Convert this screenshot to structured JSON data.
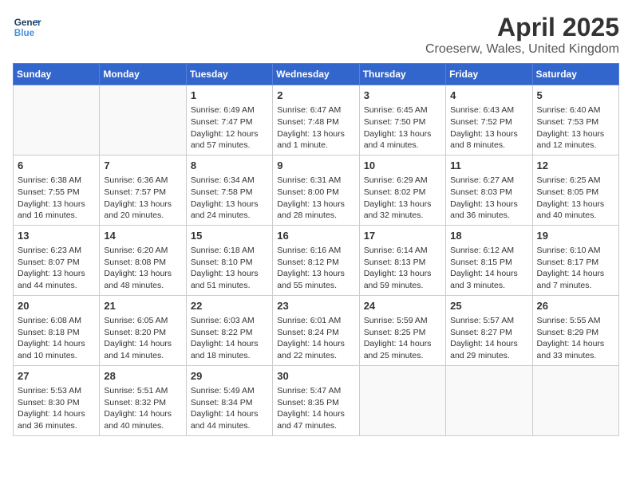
{
  "header": {
    "logo_line1": "General",
    "logo_line2": "Blue",
    "title": "April 2025",
    "subtitle": "Croeserw, Wales, United Kingdom"
  },
  "days_of_week": [
    "Sunday",
    "Monday",
    "Tuesday",
    "Wednesday",
    "Thursday",
    "Friday",
    "Saturday"
  ],
  "weeks": [
    [
      {
        "day": "",
        "detail": ""
      },
      {
        "day": "",
        "detail": ""
      },
      {
        "day": "1",
        "detail": "Sunrise: 6:49 AM\nSunset: 7:47 PM\nDaylight: 12 hours and 57 minutes."
      },
      {
        "day": "2",
        "detail": "Sunrise: 6:47 AM\nSunset: 7:48 PM\nDaylight: 13 hours and 1 minute."
      },
      {
        "day": "3",
        "detail": "Sunrise: 6:45 AM\nSunset: 7:50 PM\nDaylight: 13 hours and 4 minutes."
      },
      {
        "day": "4",
        "detail": "Sunrise: 6:43 AM\nSunset: 7:52 PM\nDaylight: 13 hours and 8 minutes."
      },
      {
        "day": "5",
        "detail": "Sunrise: 6:40 AM\nSunset: 7:53 PM\nDaylight: 13 hours and 12 minutes."
      }
    ],
    [
      {
        "day": "6",
        "detail": "Sunrise: 6:38 AM\nSunset: 7:55 PM\nDaylight: 13 hours and 16 minutes."
      },
      {
        "day": "7",
        "detail": "Sunrise: 6:36 AM\nSunset: 7:57 PM\nDaylight: 13 hours and 20 minutes."
      },
      {
        "day": "8",
        "detail": "Sunrise: 6:34 AM\nSunset: 7:58 PM\nDaylight: 13 hours and 24 minutes."
      },
      {
        "day": "9",
        "detail": "Sunrise: 6:31 AM\nSunset: 8:00 PM\nDaylight: 13 hours and 28 minutes."
      },
      {
        "day": "10",
        "detail": "Sunrise: 6:29 AM\nSunset: 8:02 PM\nDaylight: 13 hours and 32 minutes."
      },
      {
        "day": "11",
        "detail": "Sunrise: 6:27 AM\nSunset: 8:03 PM\nDaylight: 13 hours and 36 minutes."
      },
      {
        "day": "12",
        "detail": "Sunrise: 6:25 AM\nSunset: 8:05 PM\nDaylight: 13 hours and 40 minutes."
      }
    ],
    [
      {
        "day": "13",
        "detail": "Sunrise: 6:23 AM\nSunset: 8:07 PM\nDaylight: 13 hours and 44 minutes."
      },
      {
        "day": "14",
        "detail": "Sunrise: 6:20 AM\nSunset: 8:08 PM\nDaylight: 13 hours and 48 minutes."
      },
      {
        "day": "15",
        "detail": "Sunrise: 6:18 AM\nSunset: 8:10 PM\nDaylight: 13 hours and 51 minutes."
      },
      {
        "day": "16",
        "detail": "Sunrise: 6:16 AM\nSunset: 8:12 PM\nDaylight: 13 hours and 55 minutes."
      },
      {
        "day": "17",
        "detail": "Sunrise: 6:14 AM\nSunset: 8:13 PM\nDaylight: 13 hours and 59 minutes."
      },
      {
        "day": "18",
        "detail": "Sunrise: 6:12 AM\nSunset: 8:15 PM\nDaylight: 14 hours and 3 minutes."
      },
      {
        "day": "19",
        "detail": "Sunrise: 6:10 AM\nSunset: 8:17 PM\nDaylight: 14 hours and 7 minutes."
      }
    ],
    [
      {
        "day": "20",
        "detail": "Sunrise: 6:08 AM\nSunset: 8:18 PM\nDaylight: 14 hours and 10 minutes."
      },
      {
        "day": "21",
        "detail": "Sunrise: 6:05 AM\nSunset: 8:20 PM\nDaylight: 14 hours and 14 minutes."
      },
      {
        "day": "22",
        "detail": "Sunrise: 6:03 AM\nSunset: 8:22 PM\nDaylight: 14 hours and 18 minutes."
      },
      {
        "day": "23",
        "detail": "Sunrise: 6:01 AM\nSunset: 8:24 PM\nDaylight: 14 hours and 22 minutes."
      },
      {
        "day": "24",
        "detail": "Sunrise: 5:59 AM\nSunset: 8:25 PM\nDaylight: 14 hours and 25 minutes."
      },
      {
        "day": "25",
        "detail": "Sunrise: 5:57 AM\nSunset: 8:27 PM\nDaylight: 14 hours and 29 minutes."
      },
      {
        "day": "26",
        "detail": "Sunrise: 5:55 AM\nSunset: 8:29 PM\nDaylight: 14 hours and 33 minutes."
      }
    ],
    [
      {
        "day": "27",
        "detail": "Sunrise: 5:53 AM\nSunset: 8:30 PM\nDaylight: 14 hours and 36 minutes."
      },
      {
        "day": "28",
        "detail": "Sunrise: 5:51 AM\nSunset: 8:32 PM\nDaylight: 14 hours and 40 minutes."
      },
      {
        "day": "29",
        "detail": "Sunrise: 5:49 AM\nSunset: 8:34 PM\nDaylight: 14 hours and 44 minutes."
      },
      {
        "day": "30",
        "detail": "Sunrise: 5:47 AM\nSunset: 8:35 PM\nDaylight: 14 hours and 47 minutes."
      },
      {
        "day": "",
        "detail": ""
      },
      {
        "day": "",
        "detail": ""
      },
      {
        "day": "",
        "detail": ""
      }
    ]
  ]
}
